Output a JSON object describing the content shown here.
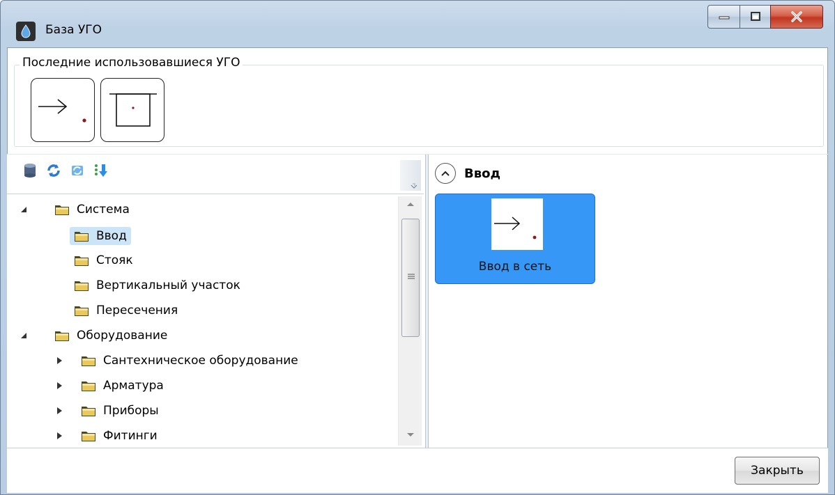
{
  "window": {
    "title": "База УГО",
    "icon": "drop-icon"
  },
  "recent": {
    "legend": "Последние использовавшиеся УГО",
    "items": [
      {
        "icon": "input-arrow-symbol"
      },
      {
        "icon": "box-symbol"
      }
    ]
  },
  "toolbar": {
    "icons": [
      "database-icon",
      "refresh-icon",
      "sync-icon",
      "sort-down-icon"
    ]
  },
  "tree": {
    "items": [
      {
        "label": "Система",
        "expanded": true,
        "level": 0
      },
      {
        "label": "Ввод",
        "selected": true,
        "level": 1
      },
      {
        "label": "Стояк",
        "level": 1
      },
      {
        "label": "Вертикальный участок",
        "level": 1
      },
      {
        "label": "Пересечения",
        "level": 1
      },
      {
        "label": "Оборудование",
        "expanded": true,
        "level": 0
      },
      {
        "label": "Сантехническое оборудование",
        "expanded": false,
        "level": 1
      },
      {
        "label": "Арматура",
        "expanded": false,
        "level": 1
      },
      {
        "label": "Приборы",
        "expanded": false,
        "level": 1
      },
      {
        "label": "Фитинги",
        "expanded": false,
        "level": 1
      }
    ]
  },
  "results": {
    "group_title": "Ввод",
    "items": [
      {
        "caption": "Ввод в сеть",
        "icon": "input-arrow-symbol"
      }
    ]
  },
  "footer": {
    "close_label": "Закрыть"
  },
  "colors": {
    "accent": "#3797f6",
    "selection": "#cce4f7",
    "close_button_red": "#c1351f"
  }
}
